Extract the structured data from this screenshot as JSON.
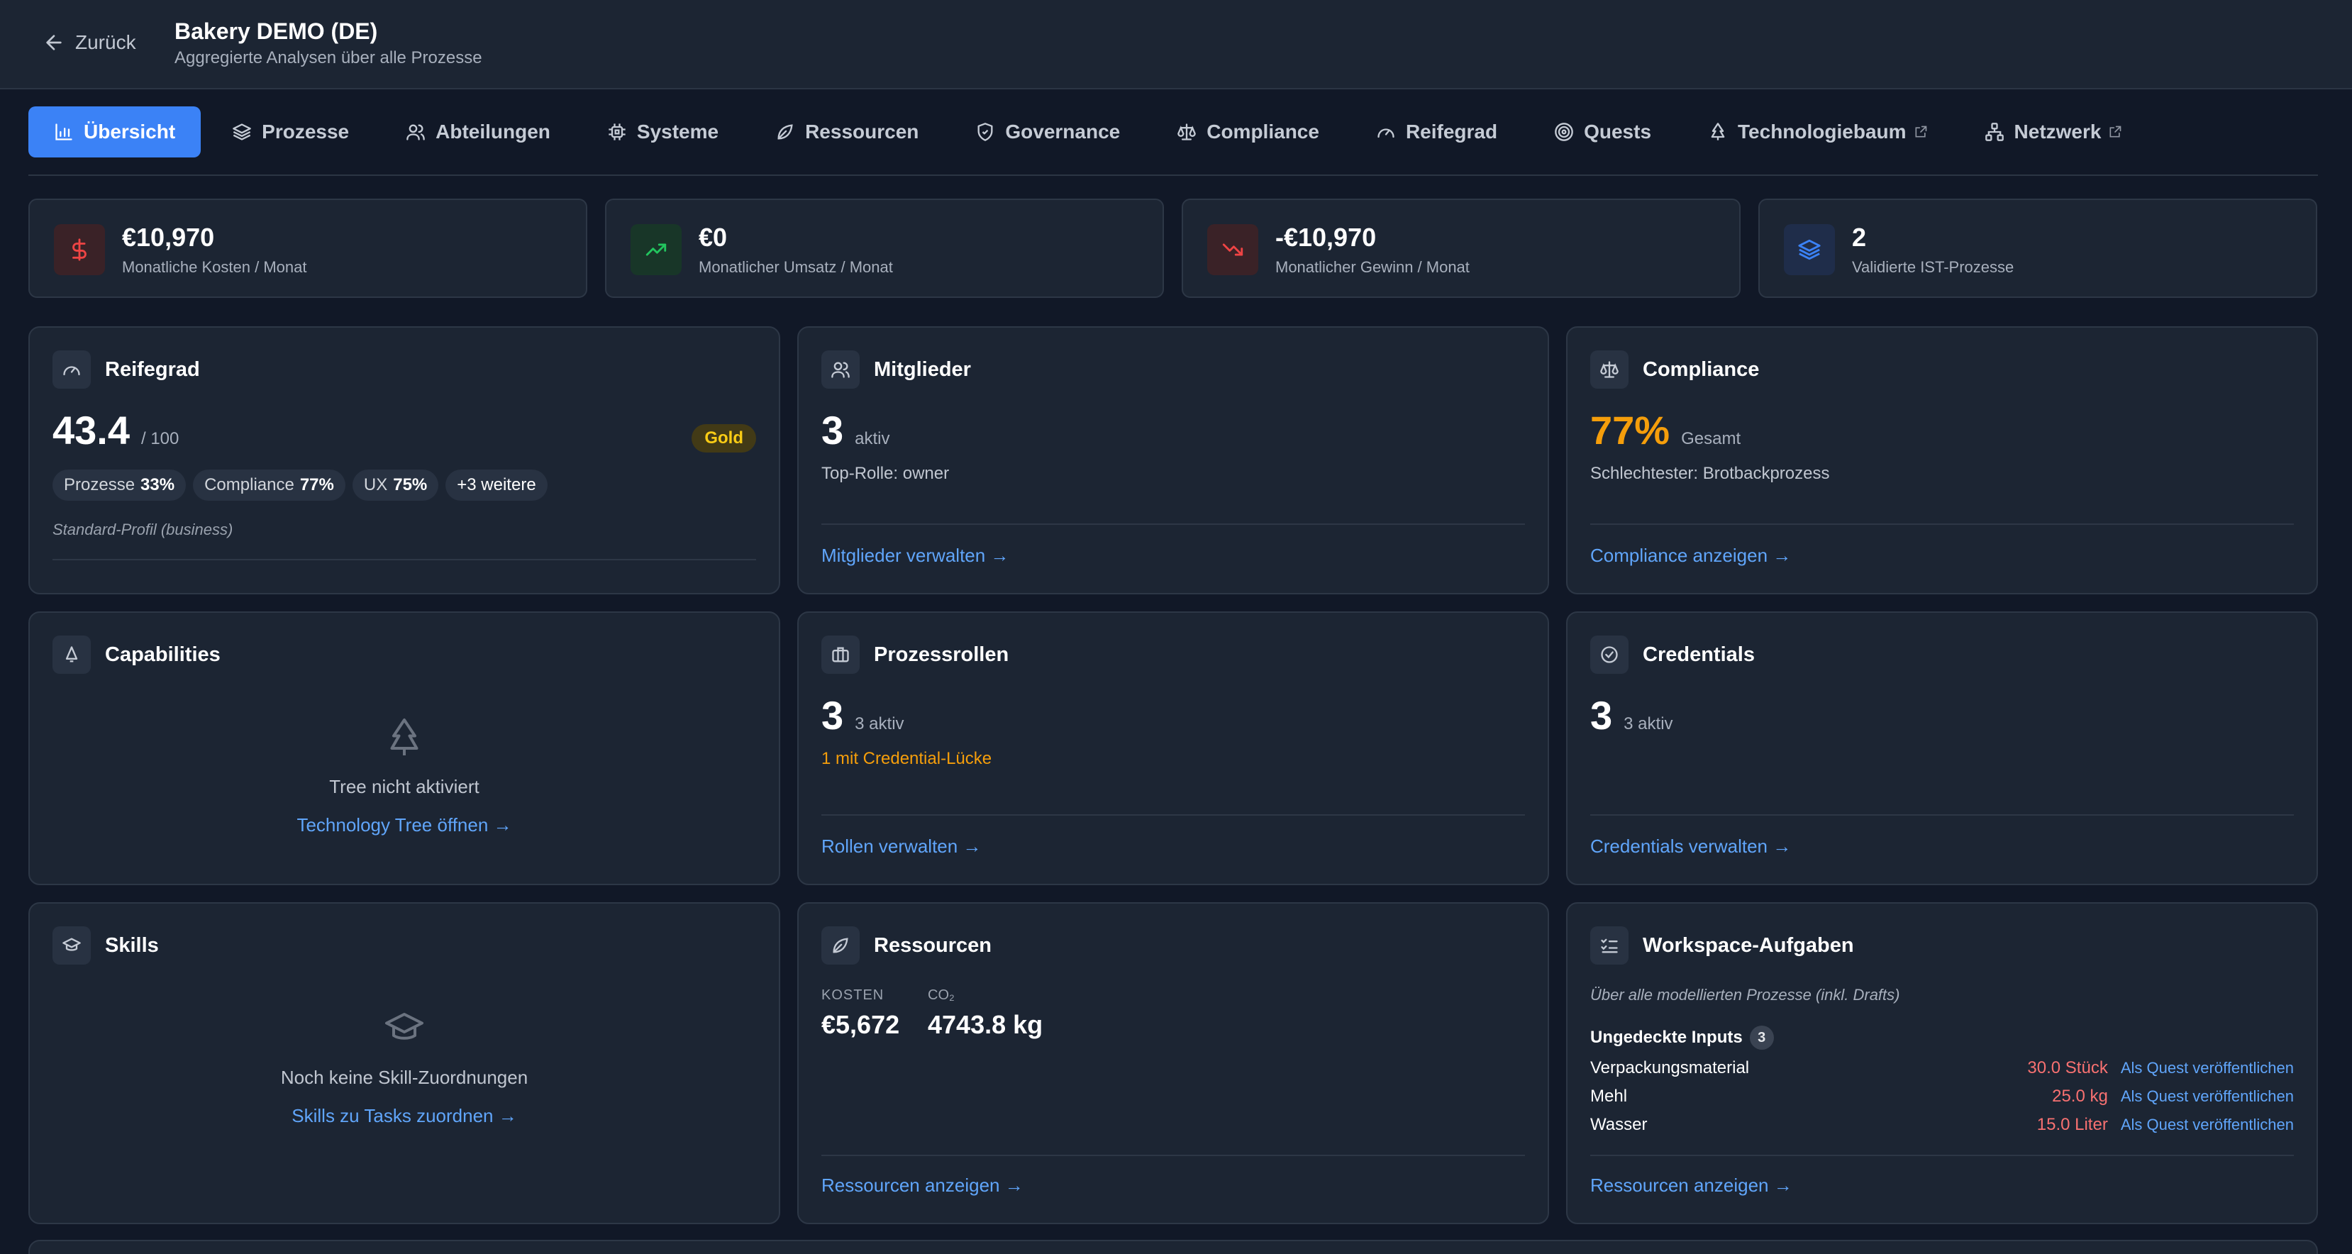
{
  "header": {
    "back_label": "Zurück",
    "title": "Bakery DEMO (DE)",
    "subtitle": "Aggregierte Analysen über alle Prozesse"
  },
  "tabs": [
    {
      "label": "Übersicht",
      "icon": "bar-chart-icon",
      "active": true
    },
    {
      "label": "Prozesse",
      "icon": "layers-icon"
    },
    {
      "label": "Abteilungen",
      "icon": "users-icon"
    },
    {
      "label": "Systeme",
      "icon": "cpu-icon"
    },
    {
      "label": "Ressourcen",
      "icon": "leaf-icon"
    },
    {
      "label": "Governance",
      "icon": "shield-icon"
    },
    {
      "label": "Compliance",
      "icon": "scale-icon"
    },
    {
      "label": "Reifegrad",
      "icon": "gauge-icon"
    },
    {
      "label": "Quests",
      "icon": "target-icon"
    },
    {
      "label": "Technologiebaum",
      "icon": "tree-icon",
      "external": true
    },
    {
      "label": "Netzwerk",
      "icon": "network-icon",
      "external": true
    }
  ],
  "kpis": [
    {
      "value": "€10,970",
      "label": "Monatliche Kosten / Monat",
      "icon": "dollar-icon",
      "color": "#ef4444"
    },
    {
      "value": "€0",
      "label": "Monatlicher Umsatz / Monat",
      "icon": "trending-up-icon",
      "color": "#22c55e"
    },
    {
      "value": "-€10,970",
      "label": "Monatlicher Gewinn / Monat",
      "icon": "trending-down-icon",
      "color": "#ef4444"
    },
    {
      "value": "2",
      "label": "Validierte IST-Prozesse",
      "icon": "layers-icon",
      "color": "#3b82f6"
    }
  ],
  "reifegrad": {
    "title": "Reifegrad",
    "score": "43.4",
    "max": "/ 100",
    "badge": "Gold",
    "pills": [
      {
        "label": "Prozesse",
        "value": "33%"
      },
      {
        "label": "Compliance",
        "value": "77%"
      },
      {
        "label": "UX",
        "value": "75%"
      }
    ],
    "more": "+3 weitere",
    "profile": "Standard-Profil (business)"
  },
  "mitglieder": {
    "title": "Mitglieder",
    "count": "3",
    "unit": "aktiv",
    "top_role": "Top-Rolle: owner",
    "link": "Mitglieder verwalten →"
  },
  "compliance": {
    "title": "Compliance",
    "value": "77%",
    "unit": "Gesamt",
    "worst": "Schlechtester: Brotbackprozess",
    "link": "Compliance anzeigen →"
  },
  "capabilities": {
    "title": "Capabilities",
    "empty": "Tree nicht aktiviert",
    "link": "Technology Tree öffnen →"
  },
  "prozessrollen": {
    "title": "Prozessrollen",
    "count": "3",
    "unit": "3 aktiv",
    "gap": "1 mit Credential-Lücke",
    "link": "Rollen verwalten →"
  },
  "credentials": {
    "title": "Credentials",
    "count": "3",
    "unit": "3 aktiv",
    "link": "Credentials verwalten →"
  },
  "skills": {
    "title": "Skills",
    "empty": "Noch keine Skill-Zuordnungen",
    "link": "Skills zu Tasks zuordnen →"
  },
  "ressourcen": {
    "title": "Ressourcen",
    "cost_label": "KOSTEN",
    "cost_value": "€5,672",
    "co2_label": "CO₂",
    "co2_value": "4743.8 kg",
    "link": "Ressourcen anzeigen →"
  },
  "workspace": {
    "title": "Workspace-Aufgaben",
    "note": "Über alle modellierten Prozesse (inkl. Drafts)",
    "inputs_label": "Ungedeckte Inputs",
    "inputs_count": "3",
    "rows": [
      {
        "name": "Verpackungsmaterial",
        "qty": "30.0 Stück",
        "action": "Als Quest veröffentlichen"
      },
      {
        "name": "Mehl",
        "qty": "25.0 kg",
        "action": "Als Quest veröffentlichen"
      },
      {
        "name": "Wasser",
        "qty": "15.0 Liter",
        "action": "Als Quest veröffentlichen"
      }
    ],
    "link": "Ressourcen anzeigen →"
  }
}
